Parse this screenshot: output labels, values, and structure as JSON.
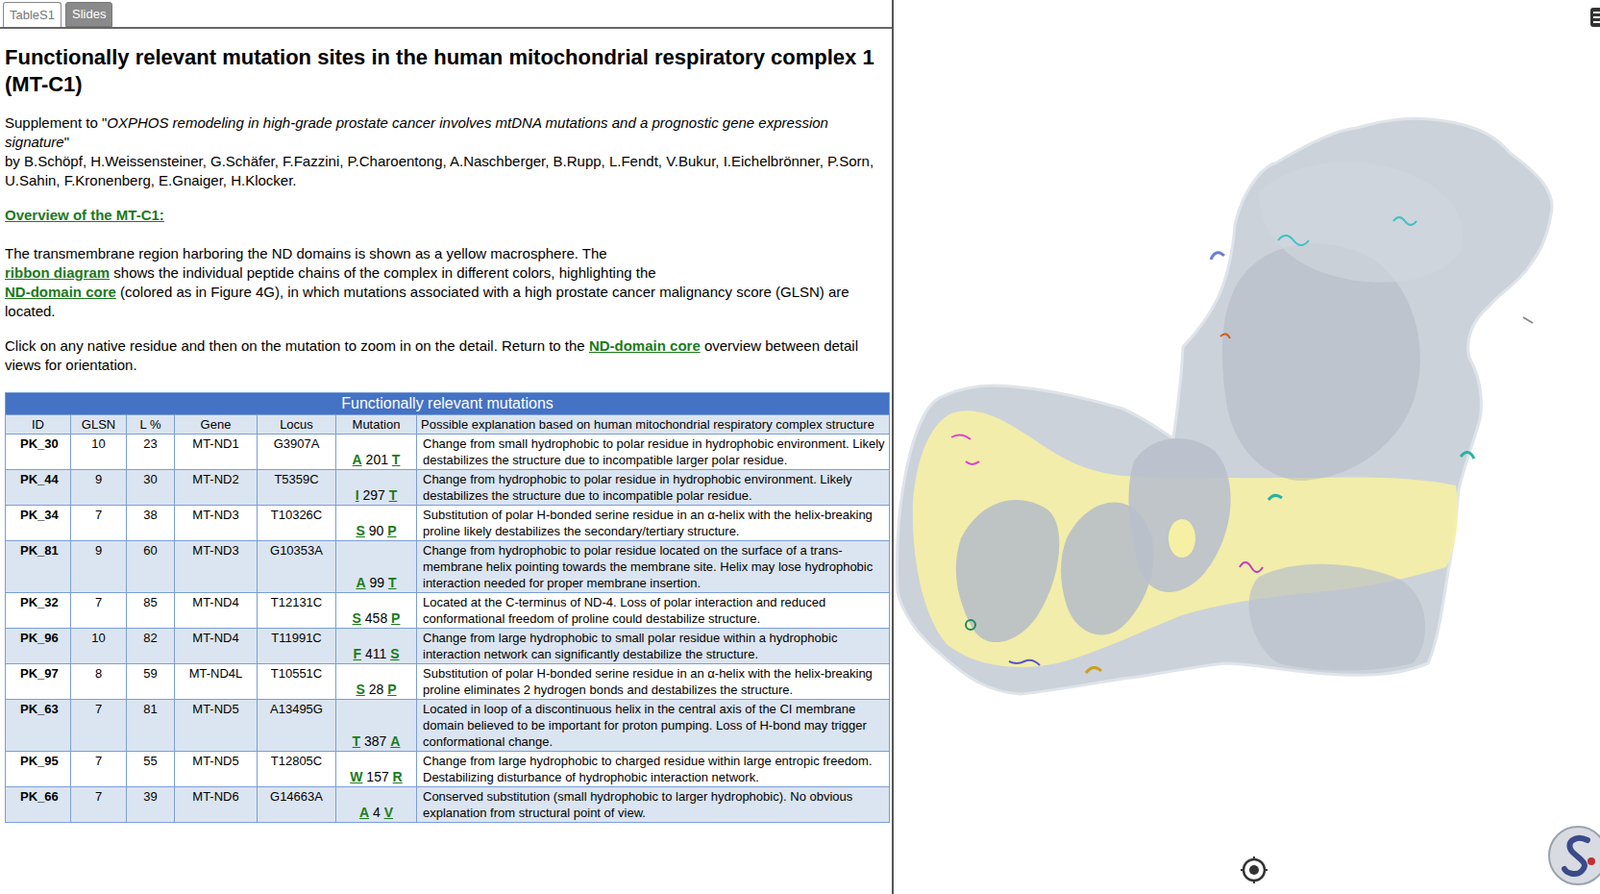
{
  "tabs": [
    {
      "label": "TableS1",
      "selected": true
    },
    {
      "label": "Slides",
      "selected": false
    }
  ],
  "title": "Functionally relevant mutation sites in the human mitochondrial respiratory complex 1 (MT-C1)",
  "supplement": {
    "prefix": "Supplement to \"",
    "paper_title": "OXPHOS remodeling in high-grade prostate cancer involves mtDNA mutations and a prognostic gene expression signature",
    "suffix": "\"",
    "authors": "by B.Schöpf, H.Weissensteiner, G.Schäfer, F.Fazzini, P.Charoentong, A.Naschberger, B.Rupp, L.Fendt, V.Bukur, I.Eichelbrönner, P.Sorn, U.Sahin, F.Kronenberg, E.Gnaiger, H.Klocker."
  },
  "overview_link": "Overview of the MT-C1:",
  "intro_lines": [
    [
      {
        "kind": "text",
        "text": "The transmembrane region harboring the ND domains is shown as a yellow macrosphere. The"
      }
    ],
    [
      {
        "kind": "link",
        "text": "ribbon diagram"
      },
      {
        "kind": "text",
        "text": " shows the individual peptide chains of the complex in different colors, highlighting the"
      }
    ],
    [
      {
        "kind": "link",
        "text": "ND-domain core"
      },
      {
        "kind": "text",
        "text": " (colored as in Figure 4G),  in which mutations associated with a high prostate cancer malignancy score (GLSN) are located."
      }
    ]
  ],
  "instructions": [
    {
      "kind": "text",
      "text": "Click on any native residue and then on the mutation to zoom in on the detail. Return to the "
    },
    {
      "kind": "link",
      "text": "ND-domain core"
    },
    {
      "kind": "text",
      "text": " overview between detail views for orientation."
    }
  ],
  "table": {
    "title": "Functionally relevant mutations",
    "columns": [
      "ID",
      "GLSN",
      "L %",
      "Gene",
      "Locus",
      "Mutation",
      "Possible explanation based on human mitochondrial respiratory complex structure"
    ],
    "rows": [
      {
        "id": "PK_30",
        "glsn": "10",
        "l": "23",
        "gene": "MT-ND1",
        "locus": "G3907A",
        "mutation": {
          "from": "A",
          "position": "201",
          "to": "T"
        },
        "explanation": "Change from small hydrophobic to polar residue in hydrophobic environment. Likely destabilizes the structure due to incompatible larger polar residue."
      },
      {
        "id": "PK_44",
        "glsn": "9",
        "l": "30",
        "gene": "MT-ND2",
        "locus": "T5359C",
        "mutation": {
          "from": "I",
          "position": "297",
          "to": "T"
        },
        "explanation": "Change from hydrophobic to polar residue in hydrophobic environment. Likely destabilizes the structure due to incompatible polar residue."
      },
      {
        "id": "PK_34",
        "glsn": "7",
        "l": "38",
        "gene": "MT-ND3",
        "locus": "T10326C",
        "mutation": {
          "from": "S",
          "position": "90",
          "to": "P"
        },
        "explanation": "Substitution of polar H-bonded serine residue in an α-helix with the helix-breaking proline likely destabilizes the secondary/tertiary structure."
      },
      {
        "id": "PK_81",
        "glsn": "9",
        "l": "60",
        "gene": "MT-ND3",
        "locus": "G10353A",
        "mutation": {
          "from": "A",
          "position": "99",
          "to": "T"
        },
        "explanation": "Change from hydrophobic to polar residue located on the surface of a trans-membrane helix pointing towards the membrane site. Helix may lose hydrophobic interaction needed for proper membrane insertion."
      },
      {
        "id": "PK_32",
        "glsn": "7",
        "l": "85",
        "gene": "MT-ND4",
        "locus": "T12131C",
        "mutation": {
          "from": "S",
          "position": "458",
          "to": "P"
        },
        "explanation": "Located at the C-terminus of ND-4. Loss of polar interaction and reduced conformational freedom of proline could destabilize structure."
      },
      {
        "id": "PK_96",
        "glsn": "10",
        "l": "82",
        "gene": "MT-ND4",
        "locus": "T11991C",
        "mutation": {
          "from": "F",
          "position": "411",
          "to": "S"
        },
        "explanation": "Change from large hydrophobic to small polar residue within a hydrophobic interaction network can significantly destabilize the structure."
      },
      {
        "id": "PK_97",
        "glsn": "8",
        "l": "59",
        "gene": "MT-ND4L",
        "locus": "T10551C",
        "mutation": {
          "from": "S",
          "position": "28",
          "to": "P"
        },
        "explanation": "Substitution of polar H-bonded serine residue in an α-helix with the helix-breaking proline eliminates 2 hydrogen bonds and destabilizes the structure."
      },
      {
        "id": "PK_63",
        "glsn": "7",
        "l": "81",
        "gene": "MT-ND5",
        "locus": "A13495G",
        "mutation": {
          "from": "T",
          "position": "387",
          "to": "A"
        },
        "explanation": "Located in loop of a discontinuous helix in the central axis of the CI membrane domain believed to be important for proton pumping. Loss of H-bond may trigger conformational change."
      },
      {
        "id": "PK_95",
        "glsn": "7",
        "l": "55",
        "gene": "MT-ND5",
        "locus": "T12805C",
        "mutation": {
          "from": "W",
          "position": "157",
          "to": "R"
        },
        "explanation": "Change from large hydrophobic to charged residue within large entropic freedom. Destabilizing disturbance of hydrophobic interaction network."
      },
      {
        "id": "PK_66",
        "glsn": "7",
        "l": "39",
        "gene": "MT-ND6",
        "locus": "G14663A",
        "mutation": {
          "from": "A",
          "position": "4",
          "to": "V"
        },
        "explanation": "Conserved substitution (small hydrophobic to larger hydrophobic). No obvious explanation from structural point of view."
      }
    ]
  }
}
